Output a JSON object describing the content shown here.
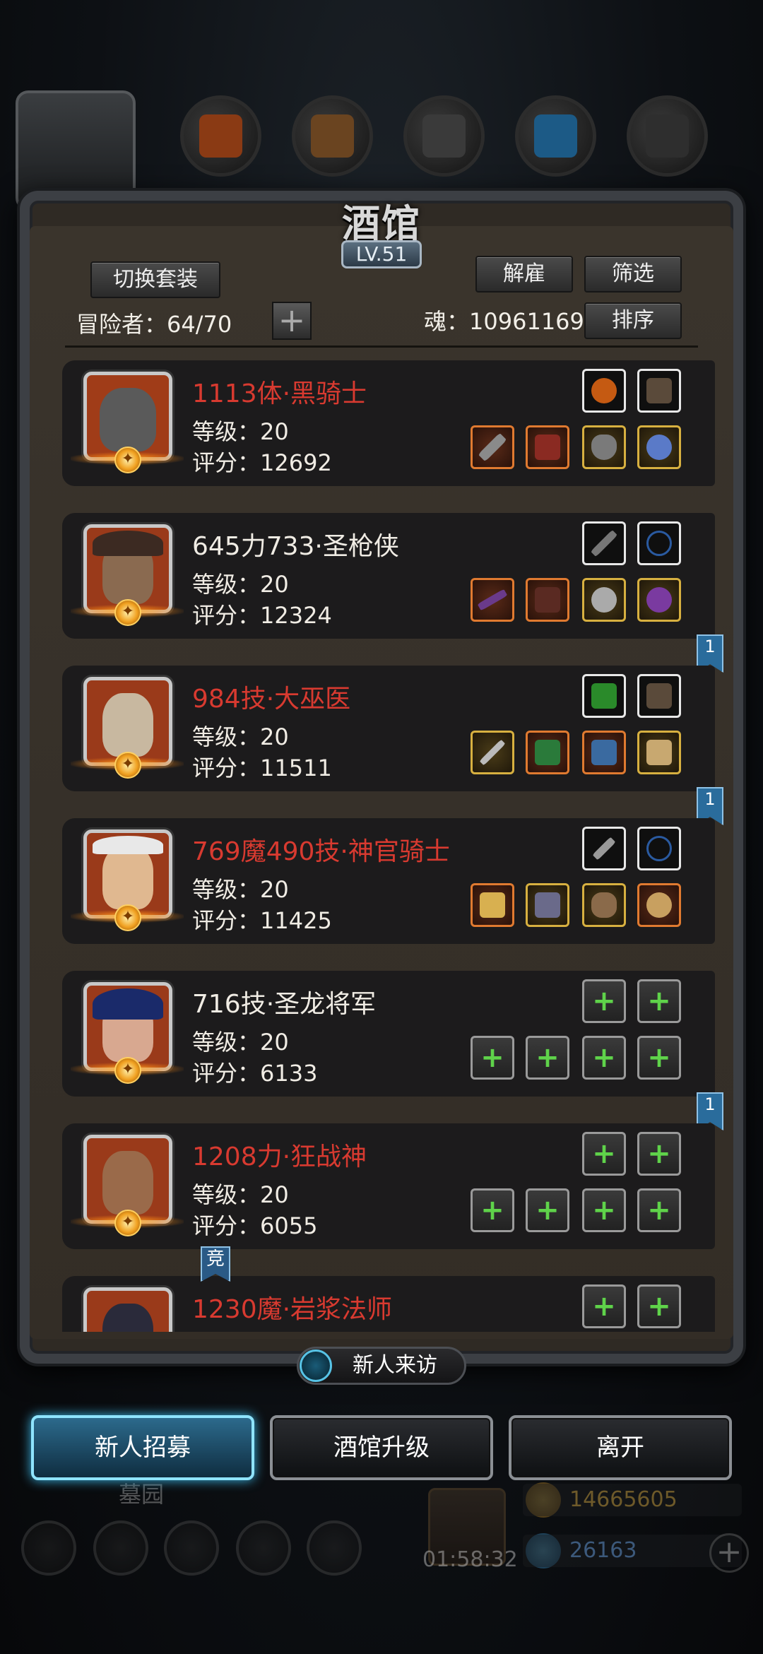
{
  "header": {
    "title": "酒馆",
    "level": "LV.51"
  },
  "top_bar": {
    "resources": [
      {
        "icon": "meat-icon"
      },
      {
        "icon": "wood-icon"
      },
      {
        "icon": "stone-icon"
      },
      {
        "icon": "crystal-icon"
      },
      {
        "icon": "iron-icon"
      }
    ]
  },
  "controls": {
    "switch_set": "切换套装",
    "dismiss": "解雇",
    "filter": "筛选",
    "sort": "排序",
    "adventurers_label": "冒险者：",
    "adventurers_count": "64/70",
    "soul_label": "魂：",
    "soul_value": "10961169"
  },
  "heroes": [
    {
      "name": "1113体·黑骑士",
      "name_color": "red",
      "level_label": "等级：",
      "level": "20",
      "score_label": "评分：",
      "score": "12692",
      "portrait": "knight-helmet",
      "bookmark": ""
    },
    {
      "name": "645力733·圣枪侠",
      "name_color": "white",
      "level_label": "等级：",
      "level": "20",
      "score_label": "评分：",
      "score": "12324",
      "portrait": "gunslinger",
      "bookmark": "1"
    },
    {
      "name": "984技·大巫医",
      "name_color": "red",
      "level_label": "等级：",
      "level": "20",
      "score_label": "评分：",
      "score": "11511",
      "portrait": "witch-doctor",
      "bookmark": "1"
    },
    {
      "name": "769魔490技·神官骑士",
      "name_color": "red",
      "level_label": "等级：",
      "level": "20",
      "score_label": "评分：",
      "score": "11425",
      "portrait": "priest-knight",
      "bookmark": ""
    },
    {
      "name": "716技·圣龙将军",
      "name_color": "white",
      "level_label": "等级：",
      "level": "20",
      "score_label": "评分：",
      "score": "6133",
      "portrait": "dragon-general",
      "bookmark": "1"
    },
    {
      "name": "1208力·狂战神",
      "name_color": "red",
      "level_label": "等级：",
      "level": "20",
      "score_label": "评分：",
      "score": "6055",
      "portrait": "berserker",
      "bookmark": ""
    },
    {
      "name": "1230魔·岩浆法师",
      "name_color": "red",
      "level_label": "",
      "level": "",
      "score_label": "",
      "score": "",
      "portrait": "lava-mage",
      "bookmark": ""
    }
  ],
  "competitive_tag": "竞",
  "visitor_button": "新人来访",
  "bottom_buttons": {
    "recruit": "新人招募",
    "upgrade": "酒馆升级",
    "leave": "离开"
  },
  "background_hud": {
    "area_label": "墓园",
    "timer": "01:58:32",
    "gold": "14665605",
    "gems": "26163"
  },
  "colors": {
    "name_red": "#d83a30",
    "accent_blue": "#3bb8e8",
    "frame": "#3c3f44"
  }
}
